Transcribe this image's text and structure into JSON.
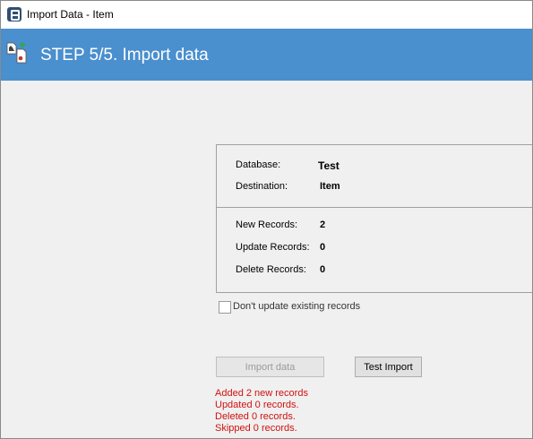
{
  "window": {
    "title": "Import Data - Item"
  },
  "header": {
    "step_title": "STEP 5/5. Import data",
    "accent": "#4a8fce"
  },
  "summary": {
    "database_label": "Database:",
    "database_value": "Test",
    "destination_label": "Destination:",
    "destination_value": "Item",
    "new_label": "New Records:",
    "new_value": "2",
    "update_label": "Update Records:",
    "update_value": "0",
    "delete_label": "Delete Records:",
    "delete_value": "0"
  },
  "options": {
    "dont_update_label": "Don't update existing records",
    "dont_update_checked": false
  },
  "buttons": {
    "import_label": "Import data",
    "test_label": "Test Import"
  },
  "results": {
    "added": "Added 2 new records",
    "updated": "Updated 0 records.",
    "deleted": "Deleted 0 records.",
    "skipped": "Skipped 0 records.",
    "color": "#d01010"
  }
}
